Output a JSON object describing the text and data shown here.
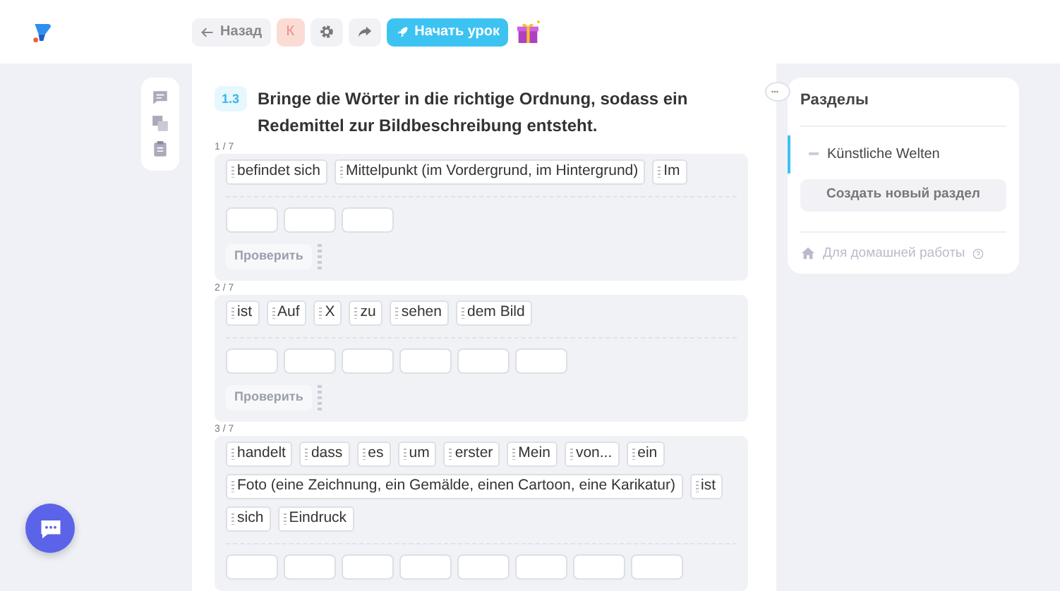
{
  "header": {
    "back": "Назад",
    "avatar": "К",
    "start_lesson": "Начать урок"
  },
  "task": {
    "number": "1.3",
    "title": "Bringe die Wörter in die richtige Ordnung, sodass ein Redemittel zur Bildbeschreibung entsteht.",
    "exercises": [
      {
        "counter": "1 / 7",
        "words": [
          "befindet sich",
          "Mittelpunkt (im Vordergrund, im Hintergrund)",
          "Im"
        ],
        "slots": [
          {
            "kind": "empty"
          },
          {
            "kind": "empty"
          },
          {
            "kind": "empty"
          }
        ],
        "check": {
          "label": "Проверить",
          "disabled": true
        }
      },
      {
        "counter": "2 / 7",
        "words": [
          "ist",
          "Auf",
          "X",
          "zu",
          "sehen",
          "dem Bild"
        ],
        "slots": [
          {
            "kind": "empty"
          },
          {
            "kind": "empty"
          },
          {
            "kind": "empty"
          },
          {
            "kind": "empty"
          },
          {
            "kind": "empty"
          },
          {
            "kind": "empty"
          }
        ],
        "check": {
          "label": "Проверить",
          "disabled": true
        }
      },
      {
        "counter": "3 / 7",
        "words": [
          "handelt",
          "dass",
          "es",
          "um",
          "erster",
          "Mein",
          "von...",
          "ein",
          "Foto (eine Zeichnung, ein Gemälde, einen Cartoon, eine Karikatur)",
          "ist",
          "sich",
          "Eindruck"
        ],
        "slots": [
          {
            "kind": "empty"
          },
          {
            "kind": "empty"
          },
          {
            "kind": "empty"
          },
          {
            "kind": "empty"
          },
          {
            "kind": "empty"
          },
          {
            "kind": "empty"
          },
          {
            "kind": "empty"
          },
          {
            "kind": "empty"
          }
        ]
      }
    ]
  },
  "sections": {
    "title": "Разделы",
    "items": [
      {
        "label": "Künstliche Welten",
        "selected": true
      }
    ],
    "create": "Создать новый раздел",
    "homework": "Для домашней работы"
  }
}
